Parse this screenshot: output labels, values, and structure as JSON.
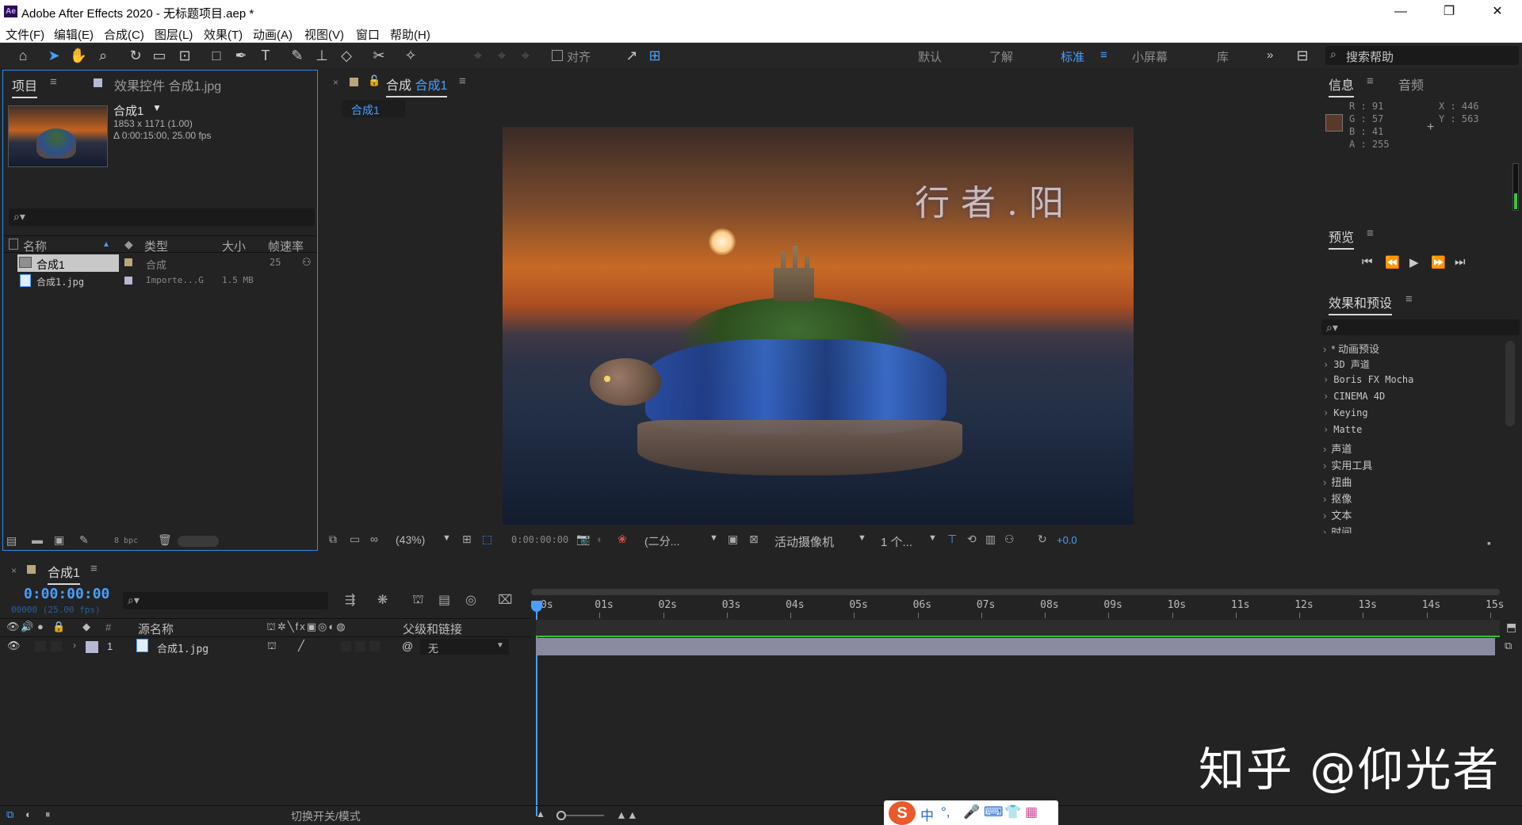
{
  "window": {
    "title": "Adobe After Effects 2020 - 无标题项目.aep *",
    "app_icon": "Ae"
  },
  "menu": [
    "文件(F)",
    "编辑(E)",
    "合成(C)",
    "图层(L)",
    "效果(T)",
    "动画(A)",
    "视图(V)",
    "窗口",
    "帮助(H)"
  ],
  "toolbar": {
    "align_label": "对齐",
    "workspaces": [
      "默认",
      "了解",
      "标准",
      "小屏幕",
      "库"
    ],
    "active_workspace": "标准",
    "search_help_placeholder": "搜索帮助"
  },
  "project": {
    "tabs": [
      "项目",
      "效果控件 合成1.jpg"
    ],
    "selected_name": "合成1",
    "selected_dims": "1853 x 1171 (1.00)",
    "selected_duration": "Δ 0:00:15:00, 25.00 fps",
    "columns": [
      "名称",
      "类型",
      "大小",
      "帧速率"
    ],
    "items": [
      {
        "name": "合成1",
        "type": "合成",
        "size": "",
        "fps": "25"
      },
      {
        "name": "合成1.jpg",
        "type": "Importe...G",
        "size": "1.5 MB",
        "fps": ""
      }
    ],
    "bpc": "8 bpc"
  },
  "viewer": {
    "tab_label": "合成",
    "comp_name": "合成1",
    "breadcrumb": "合成1",
    "zoom": "(43%)",
    "timecode": "0:00:00:00",
    "resolution": "(二分...",
    "camera": "活动摄像机",
    "views": "1 个...",
    "exposure": "+0.0",
    "canvas_text": "行 者 . 阳"
  },
  "info": {
    "tabs": [
      "信息",
      "音频"
    ],
    "r": "R : 91",
    "g": "G : 57",
    "b": "B : 41",
    "a": "A : 255",
    "x": "X : 446",
    "y": "Y : 563",
    "swatch": "#5b3929"
  },
  "preview": {
    "title": "预览"
  },
  "effects": {
    "title": "效果和预设",
    "items": [
      "* 动画预设",
      "3D 声道",
      "Boris FX Mocha",
      "CINEMA 4D",
      "Keying",
      "Matte",
      "声道",
      "实用工具",
      "扭曲",
      "抠像",
      "文本",
      "时间"
    ]
  },
  "timeline": {
    "comp_tab": "合成1",
    "timecode": "0:00:00:00",
    "frame_info": "00000 (25.00 fps)",
    "col_source": "源名称",
    "col_parent": "父级和链接",
    "col_num": "#",
    "layer": {
      "num": "1",
      "name": "合成1.jpg",
      "parent": "无"
    },
    "ruler": [
      "0s",
      "01s",
      "02s",
      "03s",
      "04s",
      "05s",
      "06s",
      "07s",
      "08s",
      "09s",
      "10s",
      "11s",
      "12s",
      "13s",
      "14s",
      "15s"
    ],
    "footer": "切换开关/模式"
  },
  "watermark": "知乎 @仰光者",
  "ime": {
    "mode": "中"
  },
  "colors": {
    "accent": "#4a9eff",
    "panel": "#232323",
    "selection": "#2d8ceb"
  }
}
